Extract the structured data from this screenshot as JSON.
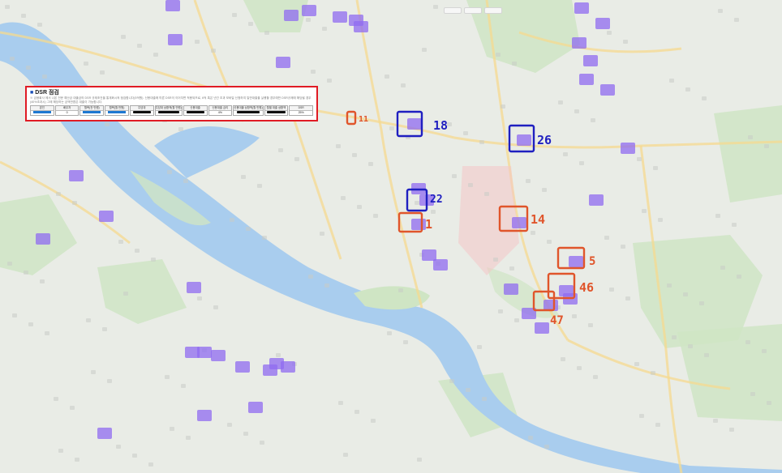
{
  "map": {
    "water_color": "#a9cdee",
    "land_color": "#e9ece6",
    "park_color": "#cfe5c4",
    "road_color": "#f6d98f",
    "pin_color": "#8f6bf0"
  },
  "dsr_panel": {
    "title": "DSR 점검",
    "note": "※ 금융회사 에서 나온 전문 예산금 대출금의 DSR 규제조건을 통계화시켜 점검합니다(5억원). 신용대출에 따른 DSR이 이어지면 적용되므로, 6억 혹은 년간 초과 모바일 신청하여 일반대출을 실행할 경우에만 DSR규제에 해당될 경우(40%초과시) 그에 해당하는 금액만큼은 대출이 가능합니다.",
    "headers": [
      "본인",
      "배우자",
      "월복(전 만원)",
      "월복(월 만원)",
      "주담대",
      "주담대 상환액(월 만원)",
      "신용대출",
      "신용대출 금리",
      "신용대출 상환액(월 만원)",
      "월별 대출 상환액",
      "DSR"
    ],
    "values": [
      "",
      "0",
      "",
      "",
      "",
      "",
      "",
      "4%",
      "",
      "",
      "25%"
    ],
    "redacted": [
      true,
      false,
      true,
      true,
      true,
      true,
      true,
      false,
      true,
      true,
      false
    ],
    "colors": {
      "border": "#e01b24",
      "bar": "#1f78d1",
      "redact": "#111111"
    }
  },
  "annotations": [
    {
      "label": "11",
      "color": "#e0552b"
    },
    {
      "label": "18",
      "color": "#1f1fc0"
    },
    {
      "label": "26",
      "color": "#1f1fc0"
    },
    {
      "label": "22",
      "color": "#1f1fc0"
    },
    {
      "label": "1",
      "color": "#e0552b"
    },
    {
      "label": "14",
      "color": "#e0552b"
    },
    {
      "label": "5",
      "color": "#e0552b"
    },
    {
      "label": "46",
      "color": "#e0552b"
    },
    {
      "label": "47",
      "color": "#e0552b"
    }
  ]
}
